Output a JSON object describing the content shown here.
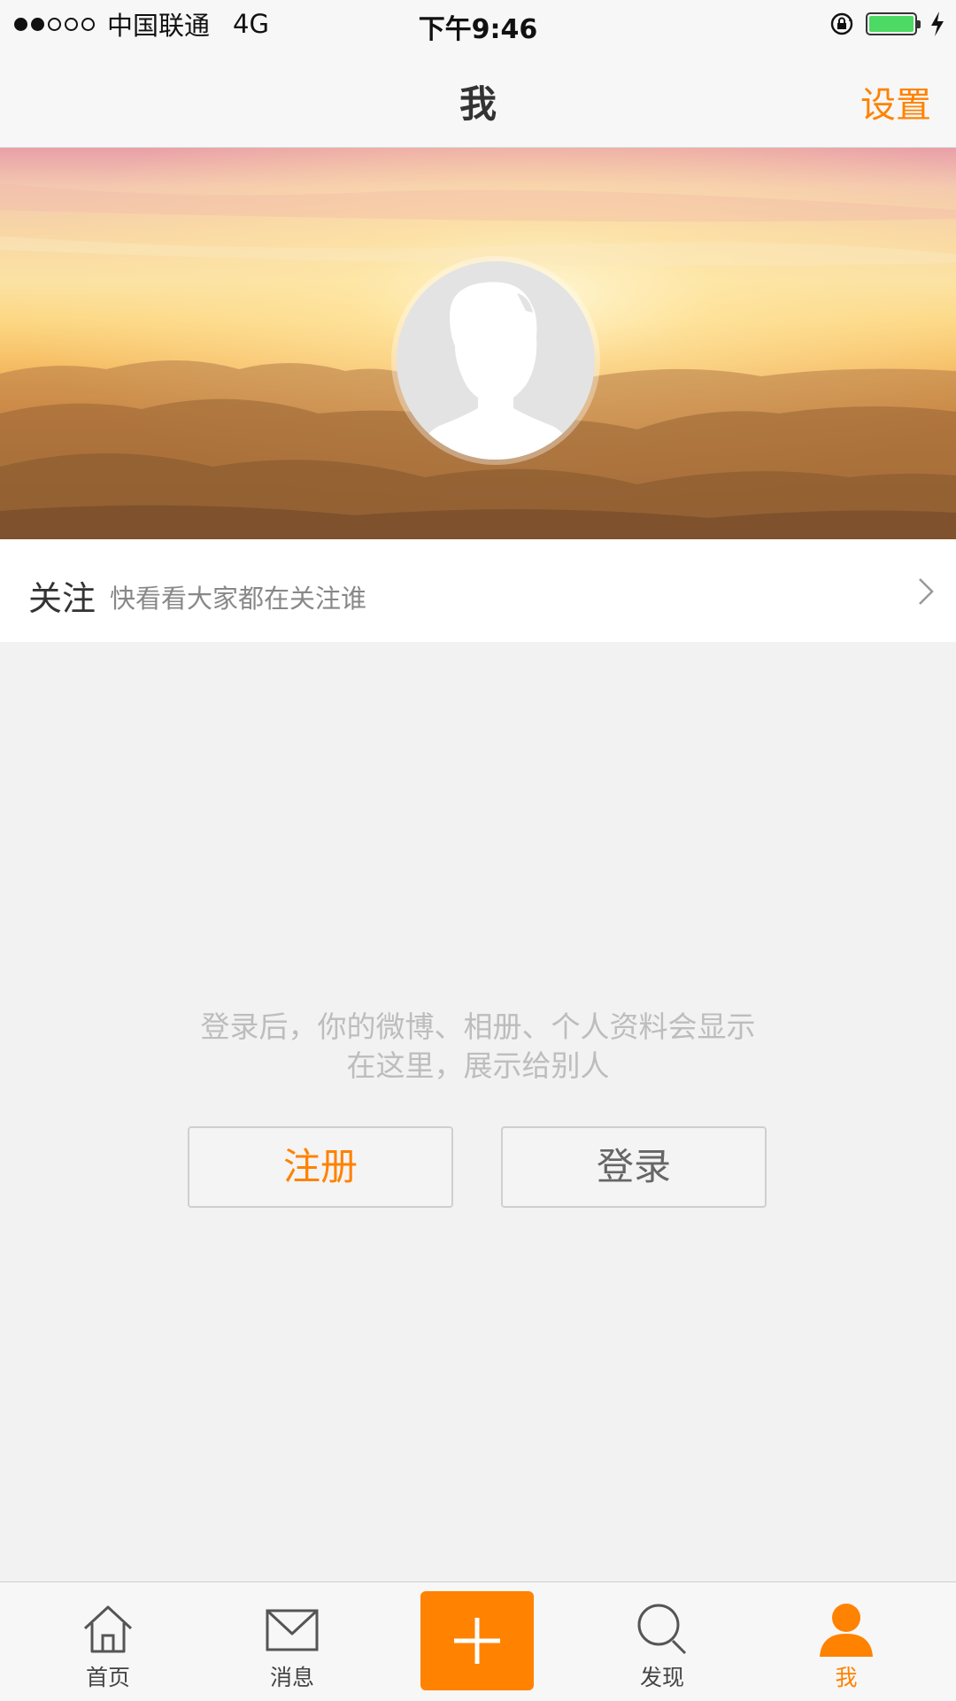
{
  "status_bar": {
    "carrier": "中国联通",
    "network": "4G",
    "time": "下午9:46",
    "signal_strength": 2,
    "battery_level": 1.0,
    "battery_color": "#4cd964",
    "icons": [
      "rotation-lock-icon",
      "battery-icon",
      "charging-icon"
    ]
  },
  "nav": {
    "title": "我",
    "settings_label": "设置",
    "accent_color": "#ff8200"
  },
  "banner": {
    "avatar_icon": "default-avatar-icon"
  },
  "follow": {
    "title": "关注",
    "description": "快看看大家都在关注谁",
    "icon": "chevron-right-icon"
  },
  "login_prompt": {
    "line1": "登录后，你的微博、相册、个人资料会显示",
    "line2": "在这里，展示给别人",
    "register_label": "注册",
    "login_label": "登录"
  },
  "tab_bar": {
    "tabs": [
      {
        "label": "首页",
        "icon": "home-icon"
      },
      {
        "label": "消息",
        "icon": "envelope-icon"
      },
      {
        "label": "",
        "icon": "plus-icon"
      },
      {
        "label": "发现",
        "icon": "search-icon"
      },
      {
        "label": "我",
        "icon": "person-icon"
      }
    ],
    "active_tab": "我"
  }
}
